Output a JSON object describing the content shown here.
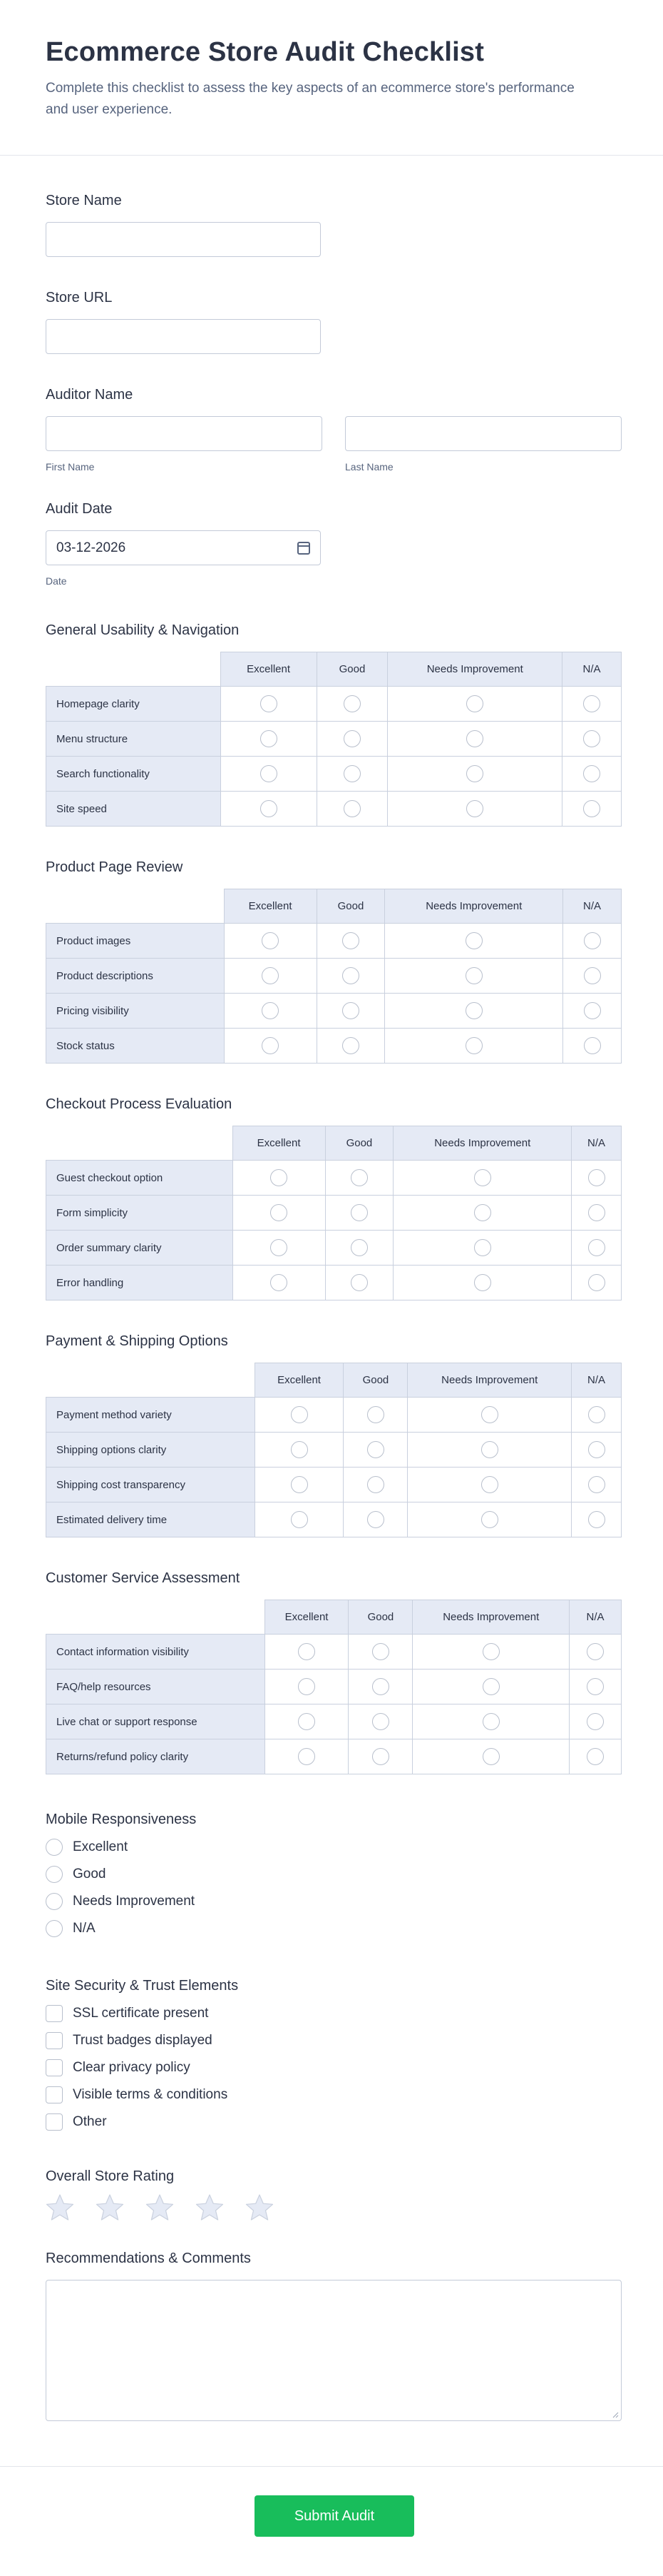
{
  "header": {
    "title": "Ecommerce Store Audit Checklist",
    "subtitle": "Complete this checklist to assess the key aspects of an ecommerce store's performance and user experience."
  },
  "store_name": {
    "label": "Store Name",
    "value": ""
  },
  "store_url": {
    "label": "Store URL",
    "value": ""
  },
  "auditor": {
    "label": "Auditor Name",
    "first_label": "First Name",
    "last_label": "Last Name"
  },
  "audit_date": {
    "label": "Audit Date",
    "value": "03-12-2026",
    "sub_label": "Date",
    "icon": "calendar-icon"
  },
  "matrix_columns": [
    "Excellent",
    "Good",
    "Needs Improvement",
    "N/A"
  ],
  "matrices": [
    {
      "title": "General Usability & Navigation",
      "rows": [
        "Homepage clarity",
        "Menu structure",
        "Search functionality",
        "Site speed"
      ]
    },
    {
      "title": "Product Page Review",
      "rows": [
        "Product images",
        "Product descriptions",
        "Pricing visibility",
        "Stock status"
      ]
    },
    {
      "title": "Checkout Process Evaluation",
      "rows": [
        "Guest checkout option",
        "Form simplicity",
        "Order summary clarity",
        "Error handling"
      ]
    },
    {
      "title": "Payment & Shipping Options",
      "rows": [
        "Payment method variety",
        "Shipping options clarity",
        "Shipping cost transparency",
        "Estimated delivery time"
      ]
    },
    {
      "title": "Customer Service Assessment",
      "rows": [
        "Contact information visibility",
        "FAQ/help resources",
        "Live chat or support response",
        "Returns/refund policy clarity"
      ]
    }
  ],
  "mobile": {
    "label": "Mobile Responsiveness",
    "options": [
      "Excellent",
      "Good",
      "Needs Improvement",
      "N/A"
    ]
  },
  "security": {
    "label": "Site Security & Trust Elements",
    "options": [
      "SSL certificate present",
      "Trust badges displayed",
      "Clear privacy policy",
      "Visible terms & conditions",
      "Other"
    ]
  },
  "rating": {
    "label": "Overall Store Rating",
    "max": 5,
    "value": 0,
    "icon": "star-icon",
    "color": "#e5eaf5"
  },
  "comments": {
    "label": "Recommendations & Comments",
    "value": ""
  },
  "submit": {
    "label": "Submit Audit",
    "color": "#18bd5b"
  }
}
